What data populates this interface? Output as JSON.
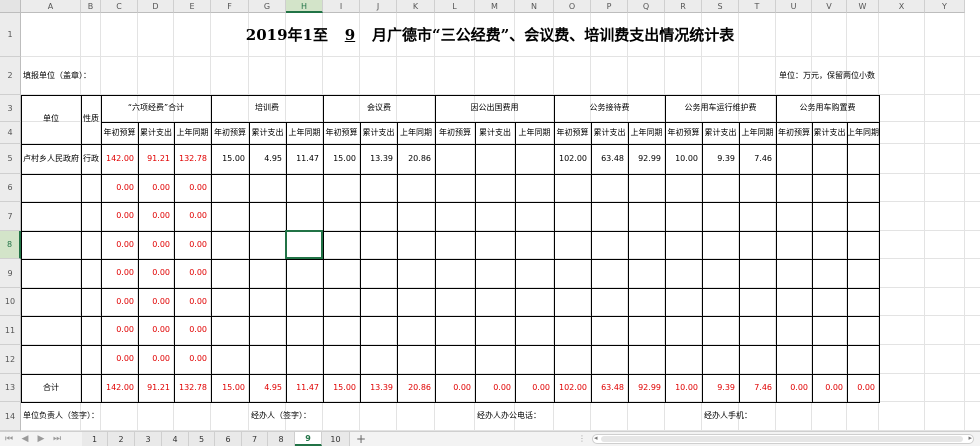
{
  "columns": [
    "A",
    "B",
    "C",
    "D",
    "E",
    "F",
    "G",
    "H",
    "I",
    "J",
    "K",
    "L",
    "M",
    "N",
    "O",
    "P",
    "Q",
    "R",
    "S",
    "T",
    "U",
    "V",
    "W",
    "X",
    "Y"
  ],
  "rows": [
    "1",
    "2",
    "3",
    "4",
    "5",
    "6",
    "7",
    "8",
    "9",
    "10",
    "11",
    "12",
    "13",
    "14"
  ],
  "selected_cell": {
    "col": "H",
    "row": "8"
  },
  "title": {
    "prefix": "2019年1至",
    "month": "9",
    "suffix": "月广德市“三公经费”、会议费、培训费支出情况统计表"
  },
  "info": {
    "unit_filler": "填报单位（盖章）：",
    "unit_note": "单位：万元，保留两位小数"
  },
  "headers": {
    "unit": "单位",
    "nature": "性质",
    "groups": [
      "“六项经费”合计",
      "培训费",
      "会议费",
      "因公出国费用",
      "公务接待费",
      "公务用车运行维护费",
      "公务用车购置费"
    ],
    "sub_budget": "年初预算",
    "sub_spent": "累计支出",
    "sub_prev": "上年同期"
  },
  "data_row": {
    "unit": "卢村乡人民政府",
    "nature": "行政",
    "values": [
      "142.00",
      "91.21",
      "132.78",
      "15.00",
      "4.95",
      "11.47",
      "15.00",
      "13.39",
      "20.86",
      "",
      "",
      "",
      "102.00",
      "63.48",
      "92.99",
      "10.00",
      "9.39",
      "7.46",
      "",
      "",
      ""
    ]
  },
  "empty_rows": [
    [
      "0.00",
      "0.00",
      "0.00"
    ],
    [
      "0.00",
      "0.00",
      "0.00"
    ],
    [
      "0.00",
      "0.00",
      "0.00"
    ],
    [
      "0.00",
      "0.00",
      "0.00"
    ],
    [
      "0.00",
      "0.00",
      "0.00"
    ],
    [
      "0.00",
      "0.00",
      "0.00"
    ],
    [
      "0.00",
      "0.00",
      "0.00"
    ]
  ],
  "total_row": {
    "label": "合计",
    "values": [
      "142.00",
      "91.21",
      "132.78",
      "15.00",
      "4.95",
      "11.47",
      "15.00",
      "13.39",
      "20.86",
      "0.00",
      "0.00",
      "0.00",
      "102.00",
      "63.48",
      "92.99",
      "10.00",
      "9.39",
      "7.46",
      "0.00",
      "0.00",
      "0.00"
    ]
  },
  "footer": {
    "person_in_charge": "单位负责人（签字）：",
    "handler": "经办人（签字）：",
    "office_phone": "经办人办公电话：",
    "mobile": "经办人手机："
  },
  "sheet_tabs": [
    "1",
    "2",
    "3",
    "4",
    "5",
    "6",
    "7",
    "8",
    "9",
    "10"
  ],
  "active_tab": "9",
  "icons": {
    "nav": [
      "first-sheet-icon",
      "prev-sheet-icon",
      "next-sheet-icon",
      "last-sheet-icon"
    ],
    "add": "add-sheet-icon"
  },
  "colors": {
    "accent": "#217346",
    "red_text": "#e00000"
  }
}
